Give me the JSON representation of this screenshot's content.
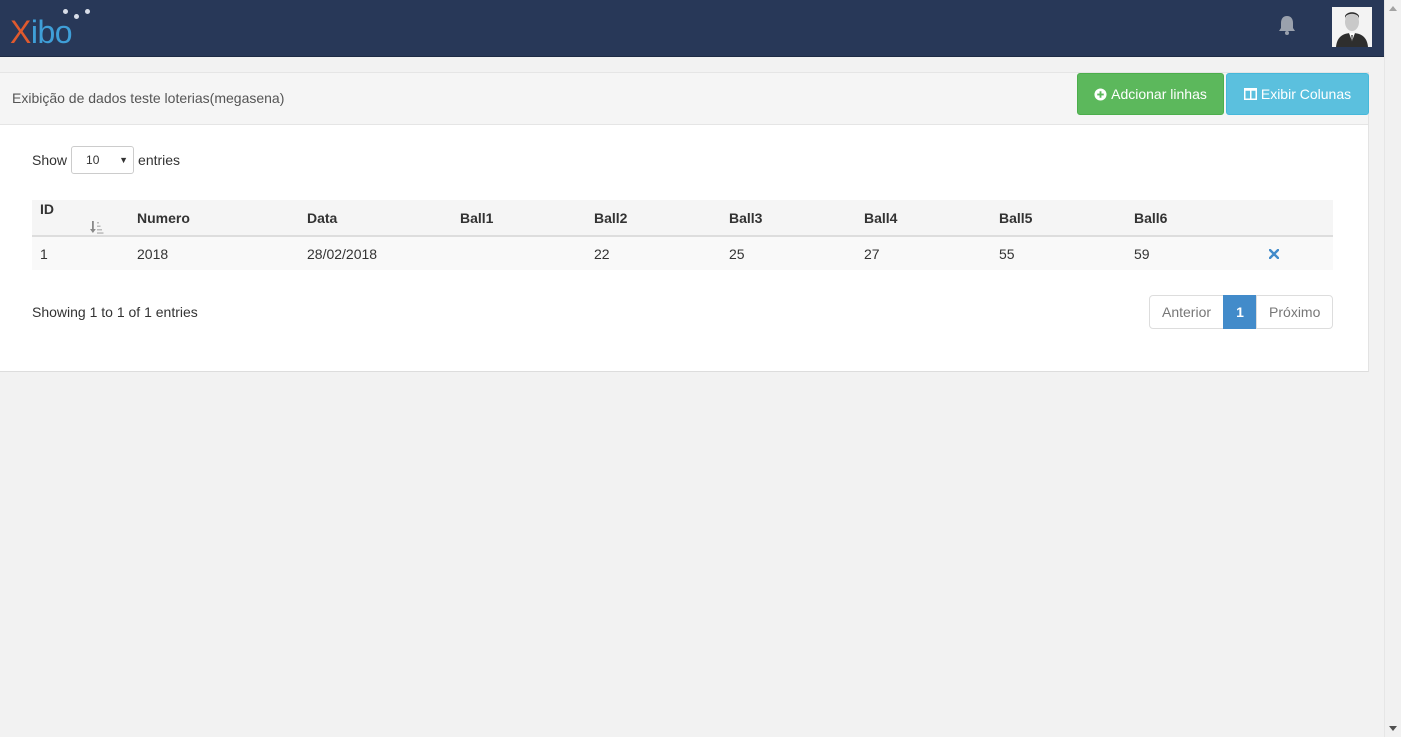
{
  "navbar": {
    "logo": {
      "x_letter": "X",
      "rest": "ibo"
    }
  },
  "panel": {
    "title": "Exibição de dados teste loterias(megasena)",
    "add_rows_label": "Adcionar linhas",
    "columns_label": "Exibir Colunas"
  },
  "length_menu": {
    "show_label": "Show",
    "value": "10",
    "entries_label": "entries"
  },
  "table": {
    "columns": [
      "ID",
      "Numero",
      "Data",
      "Ball1",
      "Ball2",
      "Ball3",
      "Ball4",
      "Ball5",
      "Ball6"
    ],
    "rows": [
      {
        "ID": "1",
        "Numero": "2018",
        "Data": "28/02/2018",
        "Ball1": "",
        "Ball2": "22",
        "Ball3": "25",
        "Ball4": "27",
        "Ball5": "55",
        "Ball6": "59"
      }
    ]
  },
  "footer": {
    "info": "Showing 1 to 1 of 1 entries",
    "prev": "Anterior",
    "page": "1",
    "next": "Próximo"
  },
  "colors": {
    "navbar": "#283858",
    "add_button": "#5cb85c",
    "columns_button": "#5bc0de",
    "active_page": "#428bca",
    "delete_icon": "#428bca"
  },
  "icons": {
    "add": "plus-circle-icon",
    "columns": "columns-icon",
    "bell": "bell-icon",
    "sort": "sort-asc-icon",
    "delete": "times-icon"
  }
}
